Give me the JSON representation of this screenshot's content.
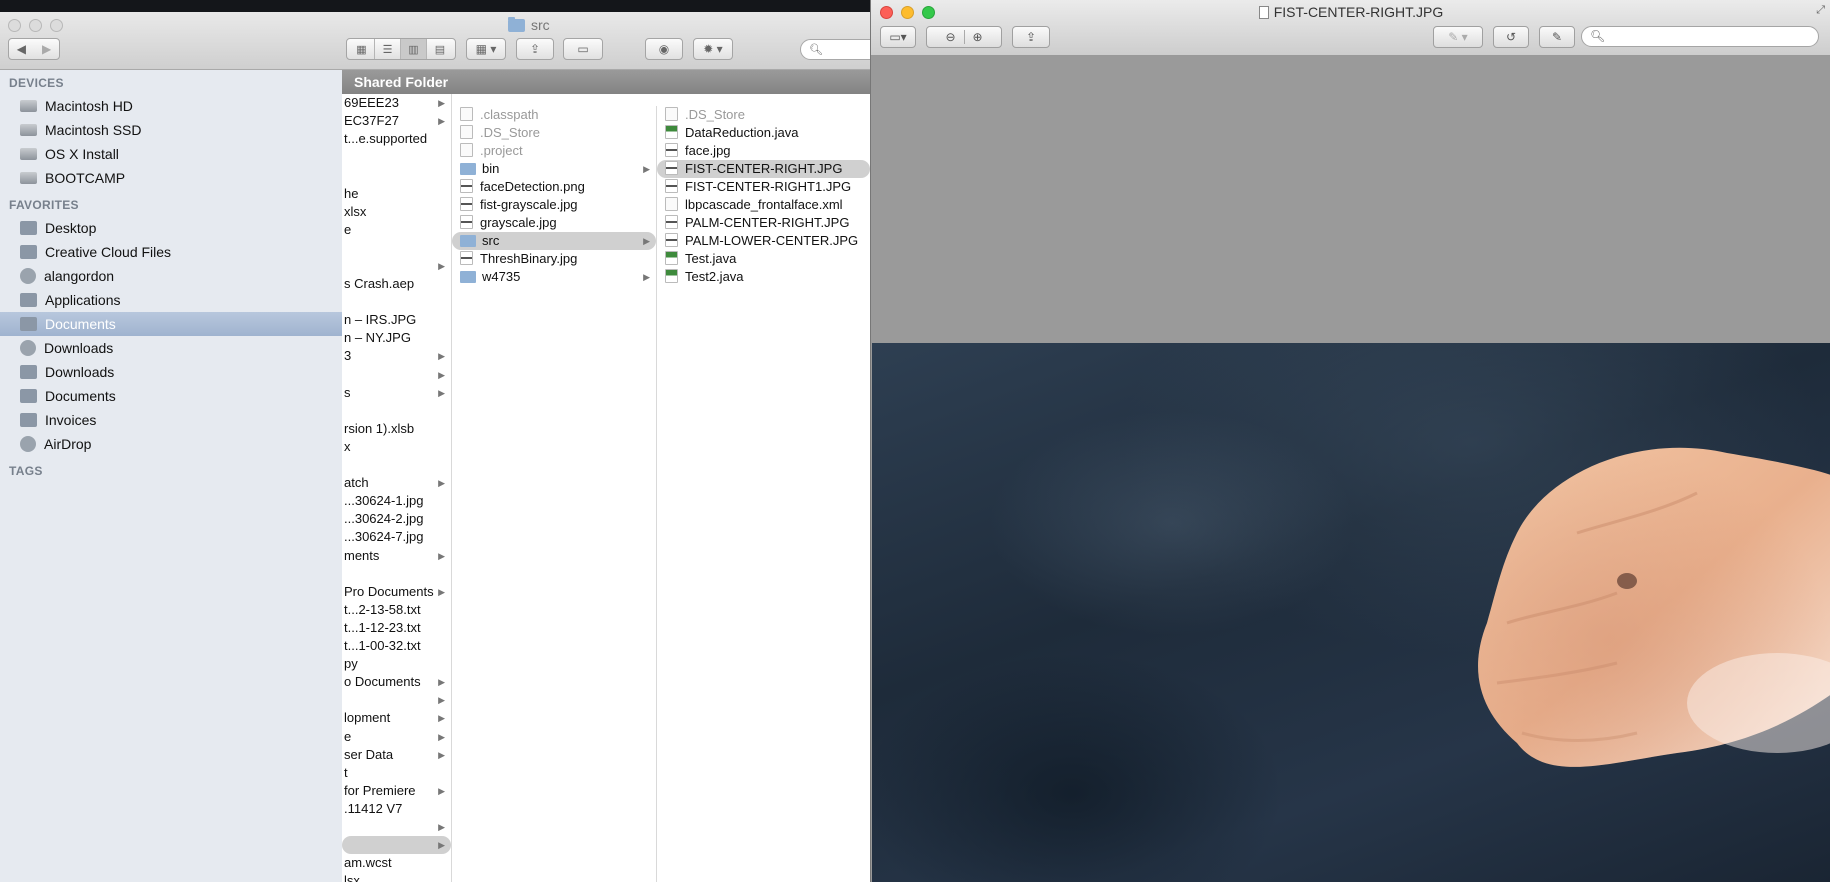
{
  "finder": {
    "window_title": "src",
    "column_header": "Shared Folder",
    "sidebar": {
      "devices_heading": "DEVICES",
      "devices": [
        {
          "label": "Macintosh HD",
          "icon": "hard-drive-icon"
        },
        {
          "label": "Macintosh SSD",
          "icon": "hard-drive-icon"
        },
        {
          "label": "OS X Install",
          "icon": "hard-drive-icon"
        },
        {
          "label": "BOOTCAMP",
          "icon": "hard-drive-icon"
        }
      ],
      "favorites_heading": "FAVORITES",
      "favorites": [
        {
          "label": "Desktop",
          "icon": "desktop-icon"
        },
        {
          "label": "Creative Cloud Files",
          "icon": "folder-icon"
        },
        {
          "label": "alangordon",
          "icon": "home-icon"
        },
        {
          "label": "Applications",
          "icon": "applications-icon"
        },
        {
          "label": "Documents",
          "icon": "documents-icon",
          "selected": true
        },
        {
          "label": "Downloads",
          "icon": "downloads-icon"
        },
        {
          "label": "Downloads",
          "icon": "folder-icon"
        },
        {
          "label": "Documents",
          "icon": "folder-icon"
        },
        {
          "label": "Invoices",
          "icon": "folder-icon"
        },
        {
          "label": "AirDrop",
          "icon": "airdrop-icon"
        }
      ],
      "tags_heading": "TAGS"
    },
    "column1": [
      {
        "label": "69EEE23",
        "arrow": true,
        "y": 0
      },
      {
        "label": "EC37F27",
        "arrow": true,
        "y": 1
      },
      {
        "label": "t...e.supported",
        "arrow": false,
        "y": 2
      },
      {
        "label": "he",
        "arrow": false,
        "y": 5
      },
      {
        "label": "xlsx",
        "arrow": false,
        "y": 6
      },
      {
        "label": "e",
        "arrow": false,
        "y": 7
      },
      {
        "label": "",
        "arrow": true,
        "y": 9
      },
      {
        "label": "s Crash.aep",
        "arrow": false,
        "y": 10
      },
      {
        "label": "n – IRS.JPG",
        "arrow": false,
        "y": 12
      },
      {
        "label": "n – NY.JPG",
        "arrow": false,
        "y": 13
      },
      {
        "label": "3",
        "arrow": true,
        "y": 14
      },
      {
        "label": "",
        "arrow": true,
        "y": 15
      },
      {
        "label": "s",
        "arrow": true,
        "y": 16
      },
      {
        "label": "rsion 1).xlsb",
        "arrow": false,
        "y": 18
      },
      {
        "label": "x",
        "arrow": false,
        "y": 19
      },
      {
        "label": "atch",
        "arrow": true,
        "y": 21
      },
      {
        "label": "...30624-1.jpg",
        "arrow": false,
        "y": 22
      },
      {
        "label": "...30624-2.jpg",
        "arrow": false,
        "y": 23
      },
      {
        "label": "...30624-7.jpg",
        "arrow": false,
        "y": 24
      },
      {
        "label": "ments",
        "arrow": true,
        "y": 25
      },
      {
        "label": "Pro Documents",
        "arrow": true,
        "y": 27
      },
      {
        "label": "t...2-13-58.txt",
        "arrow": false,
        "y": 28
      },
      {
        "label": "t...1-12-23.txt",
        "arrow": false,
        "y": 29
      },
      {
        "label": "t...1-00-32.txt",
        "arrow": false,
        "y": 30
      },
      {
        "label": "py",
        "arrow": false,
        "y": 31
      },
      {
        "label": "o Documents",
        "arrow": true,
        "y": 32
      },
      {
        "label": "",
        "arrow": true,
        "y": 33
      },
      {
        "label": "lopment",
        "arrow": true,
        "y": 34
      },
      {
        "label": "e",
        "arrow": true,
        "y": 35
      },
      {
        "label": "ser Data",
        "arrow": true,
        "y": 36
      },
      {
        "label": "t",
        "arrow": false,
        "y": 37
      },
      {
        "label": "for Premiere",
        "arrow": true,
        "y": 38
      },
      {
        "label": ".11412 V7",
        "arrow": false,
        "y": 39
      },
      {
        "label": "",
        "arrow": true,
        "y": 40
      },
      {
        "label": "",
        "arrow": true,
        "y": 41,
        "selected": true
      },
      {
        "label": "am.wcst",
        "arrow": false,
        "y": 42
      },
      {
        "label": "lsx",
        "arrow": false,
        "y": 43
      }
    ],
    "column2": [
      {
        "label": ".classpath",
        "type": "file",
        "dim": true
      },
      {
        "label": ".DS_Store",
        "type": "file",
        "dim": true
      },
      {
        "label": ".project",
        "type": "file",
        "dim": true
      },
      {
        "label": "bin",
        "type": "folder",
        "arrow": true
      },
      {
        "label": "faceDetection.png",
        "type": "img"
      },
      {
        "label": "fist-grayscale.jpg",
        "type": "img"
      },
      {
        "label": "grayscale.jpg",
        "type": "img"
      },
      {
        "label": "src",
        "type": "folder",
        "arrow": true,
        "selected": true
      },
      {
        "label": "ThreshBinary.jpg",
        "type": "img"
      },
      {
        "label": "w4735",
        "type": "folder",
        "arrow": true
      }
    ],
    "column3": [
      {
        "label": ".DS_Store",
        "type": "file",
        "dim": true
      },
      {
        "label": "DataReduction.java",
        "type": "dw"
      },
      {
        "label": "face.jpg",
        "type": "img"
      },
      {
        "label": "FIST-CENTER-RIGHT.JPG",
        "type": "img",
        "selected": true
      },
      {
        "label": "FIST-CENTER-RIGHT1.JPG",
        "type": "img"
      },
      {
        "label": "lbpcascade_frontalface.xml",
        "type": "file"
      },
      {
        "label": "PALM-CENTER-RIGHT.JPG",
        "type": "img"
      },
      {
        "label": "PALM-LOWER-CENTER.JPG",
        "type": "img"
      },
      {
        "label": "Test.java",
        "type": "dw"
      },
      {
        "label": "Test2.java",
        "type": "dw"
      }
    ]
  },
  "preview": {
    "window_title": "FIST-CENTER-RIGHT.JPG",
    "image_description_icon": "photo-of-fist"
  },
  "colors": {
    "sidebar_bg": "#e6eaf0",
    "sidebar_selected": "#a9bbd5",
    "column_header": "#8c8c8c",
    "close": "#fc5f57",
    "minimize": "#fdbc2e",
    "zoom": "#34c84a"
  }
}
